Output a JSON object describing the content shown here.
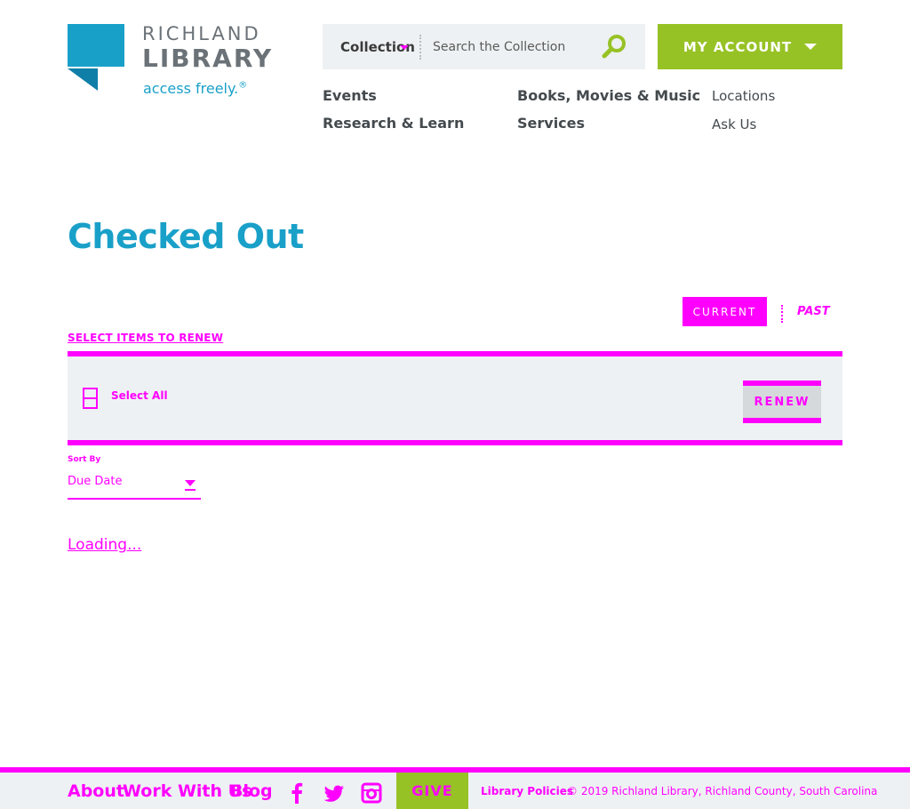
{
  "header": {
    "logo": {
      "line1": "RICHLAND",
      "line2": "LIBRARY",
      "tagline": "access freely.",
      "tagline_mark": "®"
    },
    "search": {
      "scope": "Collection",
      "placeholder": "Search the Collection"
    },
    "account_label": "MY ACCOUNT"
  },
  "nav": {
    "events": "Events",
    "books": "Books, Movies & Music",
    "locations": "Locations",
    "research": "Research & Learn",
    "services": "Services",
    "ask": "Ask Us"
  },
  "main": {
    "title": "Checked Out",
    "toggle": {
      "current": "CURRENT",
      "past": "PAST"
    },
    "select_heading": "SELECT ITEMS TO RENEW",
    "select_all": "Select All",
    "renew_label": "RENEW",
    "sort": {
      "label": "Sort By",
      "value": "Due Date"
    },
    "loading": "Loading..."
  },
  "footer": {
    "links": {
      "about": "About",
      "work": "Work With Us",
      "blog": "Blog"
    },
    "social": [
      "facebook-icon",
      "twitter-icon",
      "instagram-icon"
    ],
    "give": "GIVE",
    "policies": "Library Policies",
    "copyright": "© 2019 Richland Library, Richland County, South Carolina"
  },
  "colors": {
    "brand_blue": "#19a0c8",
    "brand_green": "#97c225",
    "placeholder_magenta": "#ff00ff",
    "panel_gray": "#eef1f3"
  }
}
